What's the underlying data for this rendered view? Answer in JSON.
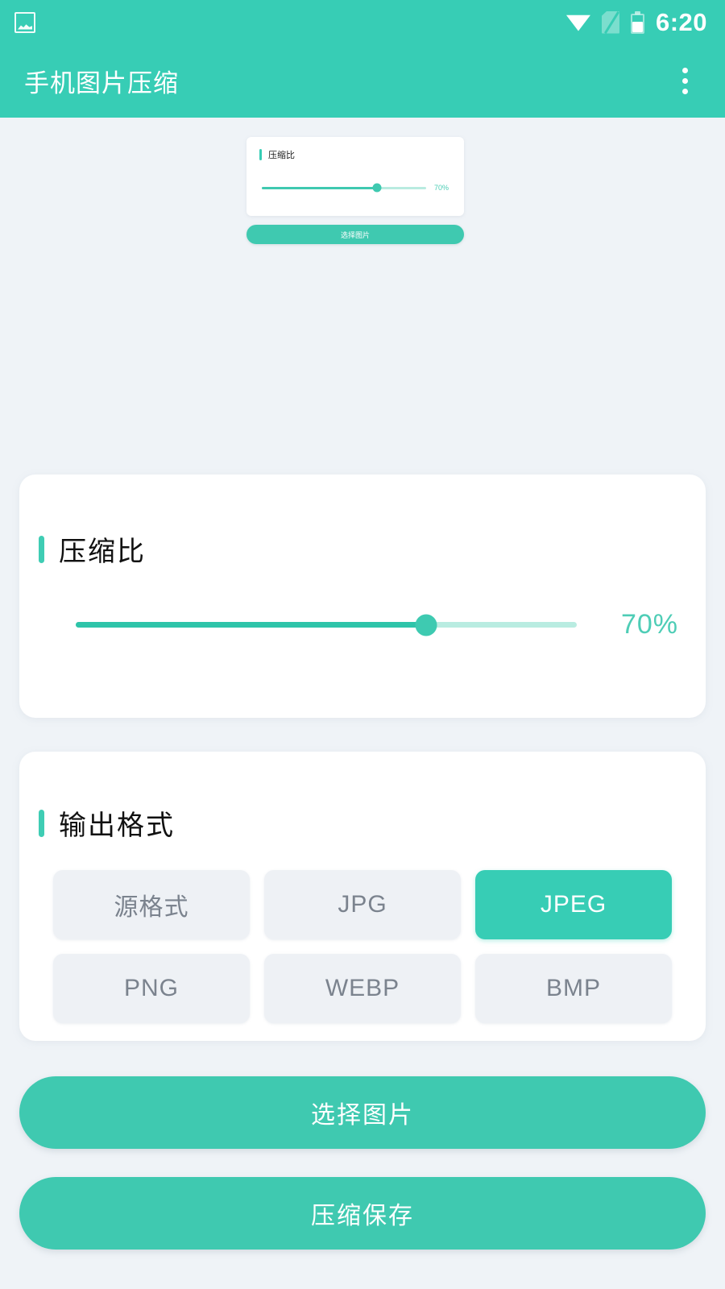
{
  "status_bar": {
    "notification_icon": "image-icon",
    "wifi_icon": "wifi-icon",
    "sim_icon": "no-sim-icon",
    "battery_icon": "battery-icon",
    "time": "6:20"
  },
  "app_bar": {
    "title": "手机图片压缩",
    "overflow_icon": "more-vertical-icon"
  },
  "mini_preview": {
    "card_title": "压缩比",
    "percent_label": "70%",
    "slider_value": 70,
    "button_label": "选择图片"
  },
  "ratio_card": {
    "title": "压缩比",
    "percent_label": "70%",
    "slider_value": 70,
    "slider_min": 0,
    "slider_max": 100
  },
  "format_card": {
    "title": "输出格式",
    "options": [
      {
        "label": "源格式",
        "selected": false
      },
      {
        "label": "JPG",
        "selected": false
      },
      {
        "label": "JPEG",
        "selected": true
      },
      {
        "label": "PNG",
        "selected": false
      },
      {
        "label": "WEBP",
        "selected": false
      },
      {
        "label": "BMP",
        "selected": false
      }
    ]
  },
  "actions": {
    "pick_label": "选择图片",
    "save_label": "压缩保存"
  },
  "colors": {
    "accent": "#37cdb5",
    "accent_light": "#b9ece1",
    "page_bg": "#eff3f7",
    "card_bg": "#ffffff",
    "chip_bg": "#eef1f5",
    "chip_text": "#7b838e"
  }
}
